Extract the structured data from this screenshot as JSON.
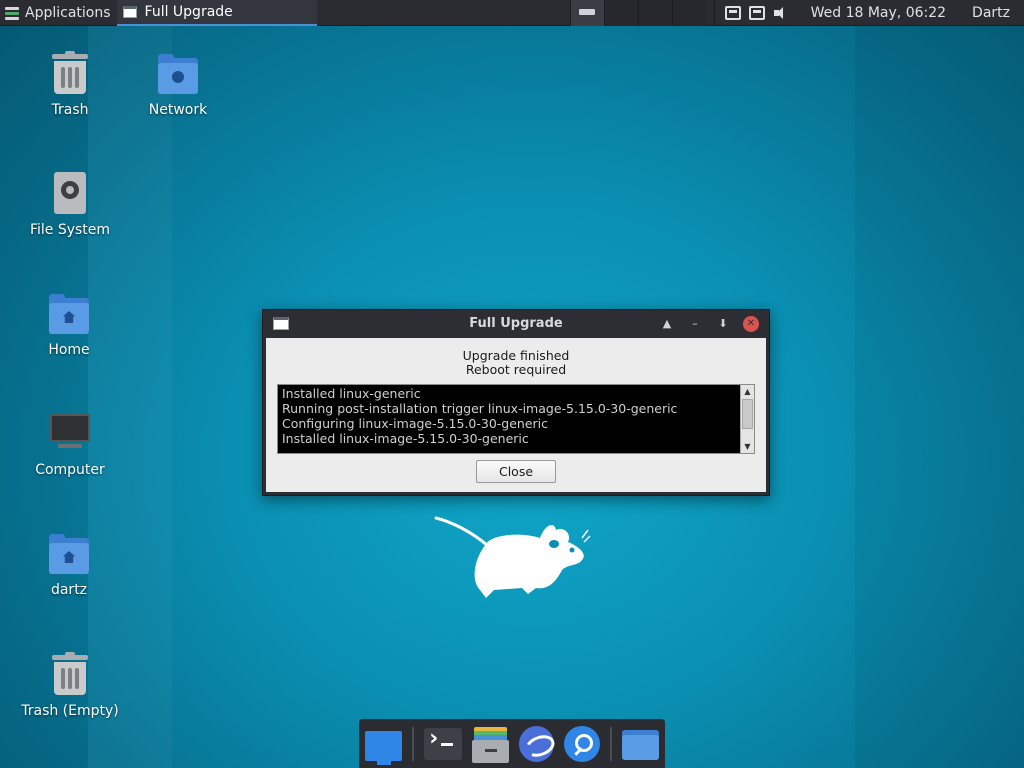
{
  "panel": {
    "apps_label": "Applications",
    "task_title": "Full Upgrade",
    "clock": "Wed 18 May, 06:22",
    "user": "Dartz"
  },
  "desktop": {
    "icons": [
      {
        "label": "Trash",
        "icon": "trash-icon"
      },
      {
        "label": "Network",
        "icon": "network-folder-icon"
      },
      {
        "label": "File System",
        "icon": "filesystem-icon"
      },
      {
        "label": "Home",
        "icon": "home-folder-icon"
      },
      {
        "label": "Computer",
        "icon": "computer-icon"
      },
      {
        "label": "dartz",
        "icon": "home-folder-icon"
      },
      {
        "label": "Trash (Empty)",
        "icon": "trash-icon"
      }
    ]
  },
  "dialog": {
    "title": "Full Upgrade",
    "message_line1": "Upgrade finished",
    "message_line2": "Reboot required",
    "log": [
      "Installed linux-generic",
      "Running post-installation trigger linux-image-5.15.0-30-generic",
      "Configuring linux-image-5.15.0-30-generic",
      "Installed linux-image-5.15.0-30-generic"
    ],
    "close_label": "Close"
  },
  "dock": {
    "items": [
      "show-desktop-icon",
      "terminal-icon",
      "file-manager-icon",
      "web-browser-icon",
      "app-finder-icon",
      "home-folder-icon"
    ]
  },
  "colors": {
    "panel_bg": "#2a2c32",
    "accent": "#4a90d9",
    "close_red": "#d9534f",
    "wallpaper": "#0a8fb2"
  }
}
